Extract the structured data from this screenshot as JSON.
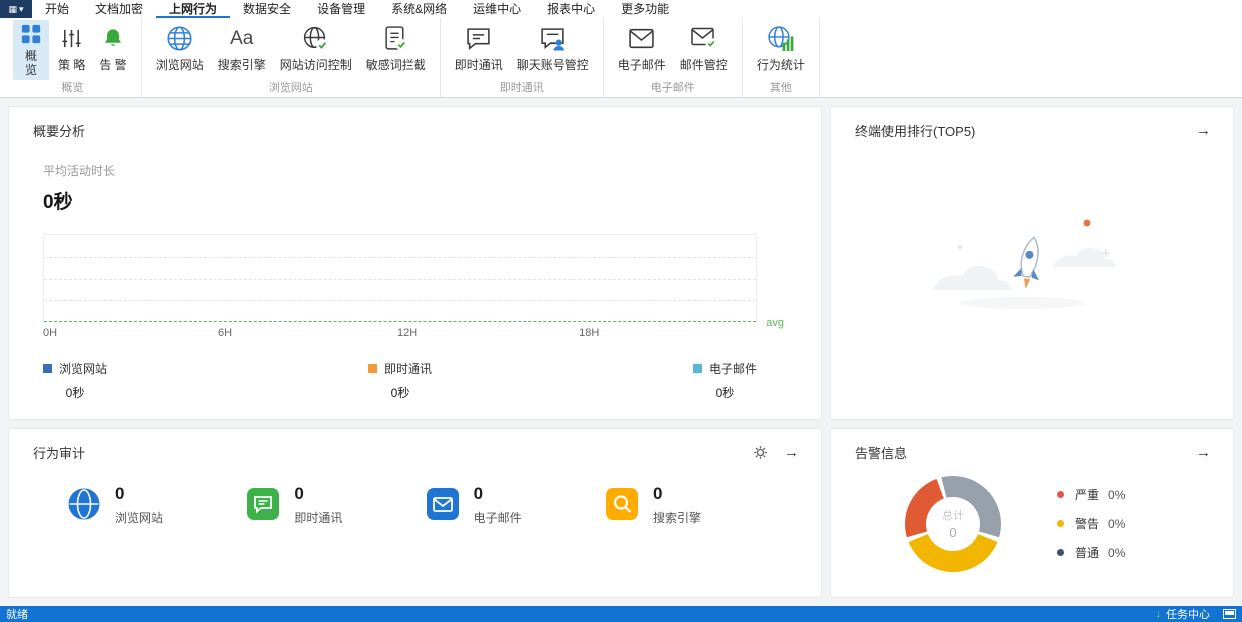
{
  "menubar": {
    "items": [
      "开始",
      "文档加密",
      "上网行为",
      "数据安全",
      "设备管理",
      "系统&网络",
      "运维中心",
      "报表中心",
      "更多功能"
    ],
    "active": "上网行为"
  },
  "ribbon": {
    "groups": [
      {
        "label": "概览",
        "buttons": [
          {
            "label": "概览",
            "icon": "overview-grid-icon",
            "selected": true
          },
          {
            "label": "策 略",
            "icon": "policy-sliders-icon",
            "selected": false
          },
          {
            "label": "告 警",
            "icon": "alert-bell-icon",
            "selected": false
          }
        ]
      },
      {
        "label": "浏览网站",
        "buttons": [
          {
            "label": "浏览网站",
            "icon": "browse-website-globe-icon",
            "selected": false
          },
          {
            "label": "搜索引擎",
            "icon": "search-engine-aa-icon",
            "selected": false
          },
          {
            "label": "网站访问控制",
            "icon": "website-access-control-icon",
            "selected": false
          },
          {
            "label": "敏感词拦截",
            "icon": "sensitive-word-block-icon",
            "selected": false
          }
        ]
      },
      {
        "label": "即时通讯",
        "buttons": [
          {
            "label": "即时通讯",
            "icon": "instant-messaging-icon",
            "selected": false
          },
          {
            "label": "聊天账号管控",
            "icon": "chat-account-control-icon",
            "selected": false
          }
        ]
      },
      {
        "label": "电子邮件",
        "buttons": [
          {
            "label": "电子邮件",
            "icon": "email-icon",
            "selected": false
          },
          {
            "label": "邮件管控",
            "icon": "email-control-icon",
            "selected": false
          }
        ]
      },
      {
        "label": "其他",
        "buttons": [
          {
            "label": "行为统计",
            "icon": "behavior-stats-icon",
            "selected": false
          }
        ]
      }
    ]
  },
  "summary_card": {
    "title": "概要分析",
    "metric_label": "平均活动时长",
    "metric_value": "0秒",
    "chart_data": {
      "type": "line",
      "x_ticks": [
        "0H",
        "6H",
        "12H",
        "18H"
      ],
      "x_range_hours": [
        0,
        24
      ],
      "series": [
        {
          "name": "浏览网站",
          "color": "#3b6fb5",
          "values": [
            0,
            0,
            0,
            0
          ]
        },
        {
          "name": "即时通讯",
          "color": "#f09a38",
          "values": [
            0,
            0,
            0,
            0
          ]
        },
        {
          "name": "电子邮件",
          "color": "#5ab6d6",
          "values": [
            0,
            0,
            0,
            0
          ]
        }
      ],
      "avg_line": {
        "label": "avg",
        "value": 0,
        "color": "#5cb85c"
      },
      "grid": "horizontal-dashed"
    },
    "legend": [
      {
        "label": "浏览网站",
        "value": "0秒",
        "color": "#3b6fb5"
      },
      {
        "label": "即时通讯",
        "value": "0秒",
        "color": "#f09a38"
      },
      {
        "label": "电子邮件",
        "value": "0秒",
        "color": "#5ab6d6"
      }
    ]
  },
  "ranking_card": {
    "title": "终端使用排行(TOP5)"
  },
  "audit_card": {
    "title": "行为审计",
    "stats": [
      {
        "label": "浏览网站",
        "value": "0",
        "icon": "globe-icon",
        "color": "#1f74d4"
      },
      {
        "label": "即时通讯",
        "value": "0",
        "icon": "chat-icon",
        "color": "#3db14a"
      },
      {
        "label": "电子邮件",
        "value": "0",
        "icon": "mail-icon",
        "color": "#1f74d4"
      },
      {
        "label": "搜索引擎",
        "value": "0",
        "icon": "search-icon",
        "color": "#ffab00"
      }
    ]
  },
  "alert_card": {
    "title": "告警信息",
    "chart_data": {
      "type": "pie",
      "center_label": "总计",
      "center_value": "0",
      "empty_color": "#97a0ab",
      "segments": [
        {
          "label": "严重",
          "value": "0%",
          "color": "#e2574c"
        },
        {
          "label": "警告",
          "value": "0%",
          "color": "#f2b600"
        },
        {
          "label": "普通",
          "value": "0%",
          "color": "#3a4f7a"
        }
      ]
    }
  },
  "statusbar": {
    "left": "就绪",
    "task_center": "任务中心"
  }
}
